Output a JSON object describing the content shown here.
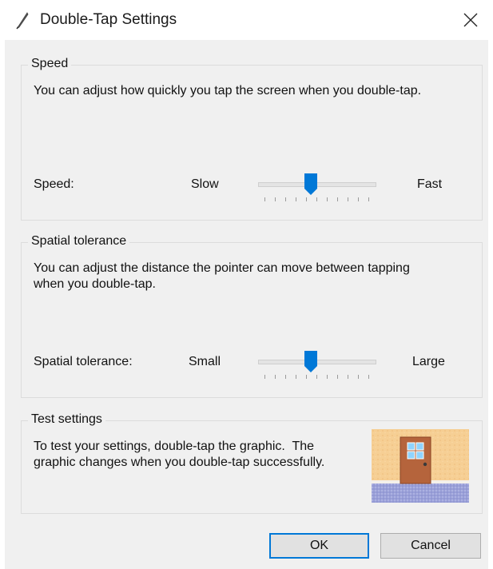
{
  "window": {
    "title": "Double-Tap Settings"
  },
  "speed": {
    "group_label": "Speed",
    "description": "You can adjust how quickly you tap the screen when you double-tap.",
    "row_label": "Speed:",
    "min_label": "Slow",
    "max_label": "Fast",
    "value": 0.45
  },
  "spatial": {
    "group_label": "Spatial tolerance",
    "description_line1": "You can adjust the distance the pointer can move between tapping",
    "description_line2": "when you double-tap.",
    "row_label": "Spatial tolerance:",
    "min_label": "Small",
    "max_label": "Large",
    "value": 0.45
  },
  "test": {
    "group_label": "Test settings",
    "description_line1": "To test your settings, double-tap the graphic.  The",
    "description_line2": "graphic changes when you double-tap successfully."
  },
  "buttons": {
    "ok_label": "OK",
    "cancel_label": "Cancel"
  },
  "colors": {
    "accent": "#0078d7"
  }
}
